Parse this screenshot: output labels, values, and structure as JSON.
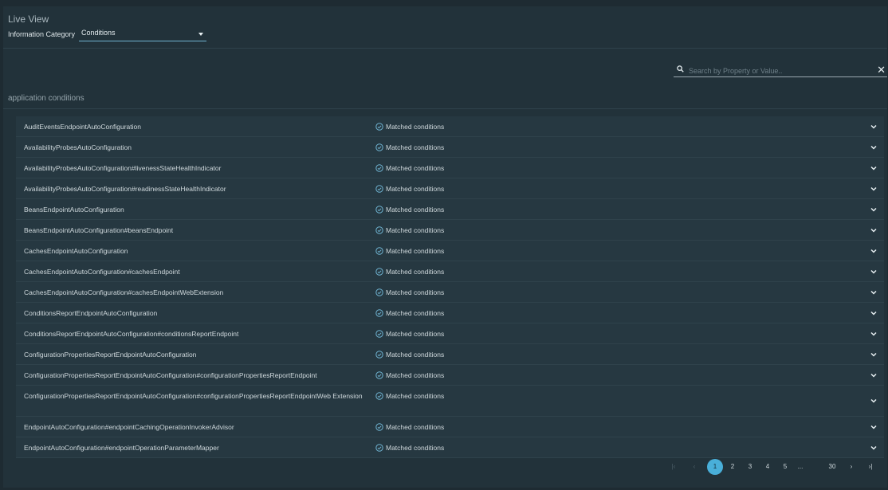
{
  "header": {
    "title": "Live View",
    "category_label": "Information Category",
    "category_value": "Conditions"
  },
  "search": {
    "placeholder": "Search by Property or Value..",
    "clear_label": "✕"
  },
  "section": {
    "title": "application conditions"
  },
  "rows": [
    {
      "name": "AuditEventsEndpointAutoConfiguration",
      "status": "Matched conditions"
    },
    {
      "name": "AvailabilityProbesAutoConfiguration",
      "status": "Matched conditions"
    },
    {
      "name": "AvailabilityProbesAutoConfiguration#livenessStateHealthIndicator",
      "status": "Matched conditions"
    },
    {
      "name": "AvailabilityProbesAutoConfiguration#readinessStateHealthIndicator",
      "status": "Matched conditions"
    },
    {
      "name": "BeansEndpointAutoConfiguration",
      "status": "Matched conditions"
    },
    {
      "name": "BeansEndpointAutoConfiguration#beansEndpoint",
      "status": "Matched conditions"
    },
    {
      "name": "CachesEndpointAutoConfiguration",
      "status": "Matched conditions"
    },
    {
      "name": "CachesEndpointAutoConfiguration#cachesEndpoint",
      "status": "Matched conditions"
    },
    {
      "name": "CachesEndpointAutoConfiguration#cachesEndpointWebExtension",
      "status": "Matched conditions"
    },
    {
      "name": "ConditionsReportEndpointAutoConfiguration",
      "status": "Matched conditions"
    },
    {
      "name": "ConditionsReportEndpointAutoConfiguration#conditionsReportEndpoint",
      "status": "Matched conditions"
    },
    {
      "name": "ConfigurationPropertiesReportEndpointAutoConfiguration",
      "status": "Matched conditions"
    },
    {
      "name": "ConfigurationPropertiesReportEndpointAutoConfiguration#configurationPropertiesReportEndpoint",
      "status": "Matched conditions"
    },
    {
      "name": "ConfigurationPropertiesReportEndpointAutoConfiguration#configurationPropertiesReportEndpointWeb Extension",
      "status": "Matched conditions"
    },
    {
      "name": "EndpointAutoConfiguration#endpointCachingOperationInvokerAdvisor",
      "status": "Matched conditions"
    },
    {
      "name": "EndpointAutoConfiguration#endpointOperationParameterMapper",
      "status": "Matched conditions"
    }
  ],
  "pagination": {
    "first": "|‹",
    "prev": "‹",
    "pages": [
      "1",
      "2",
      "3",
      "4",
      "5"
    ],
    "ellipsis": "...",
    "last_page": "30",
    "next": "›",
    "last": "›|",
    "current": "1"
  },
  "colors": {
    "accent": "#49afd9",
    "background": "#22323a",
    "row": "#263841"
  }
}
